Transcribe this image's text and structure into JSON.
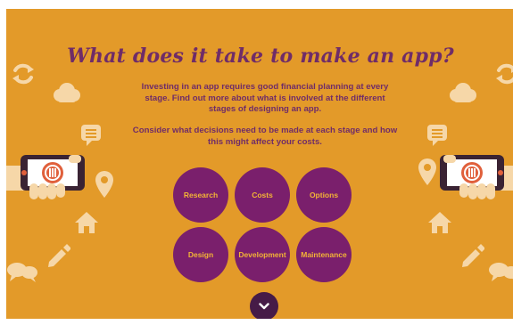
{
  "heading": "What does it take to make an app?",
  "intro_1": "Investing in an app requires good financial planning at every stage. Find out more about what is involved at the different stages of designing an app.",
  "intro_2": "Consider what decisions need to be made at each stage and how this might affect your costs.",
  "stages": {
    "research": "Research",
    "costs": "Costs",
    "options": "Options",
    "design": "Design",
    "development": "Development",
    "maintenance": "Maintenance"
  },
  "colors": {
    "background": "#e39a29",
    "circle": "#7a1f6c",
    "circle_text": "#f3b436",
    "heading": "#6f2c68",
    "down_button": "#461b47",
    "icons_light": "#f6d7a8"
  },
  "icons": [
    "refresh-icon",
    "cloud-icon",
    "chat-bubble-icon",
    "hand-phone-icon",
    "location-pin-icon",
    "home-icon",
    "pencil-icon",
    "speech-bubbles-icon",
    "chevron-down-icon"
  ]
}
